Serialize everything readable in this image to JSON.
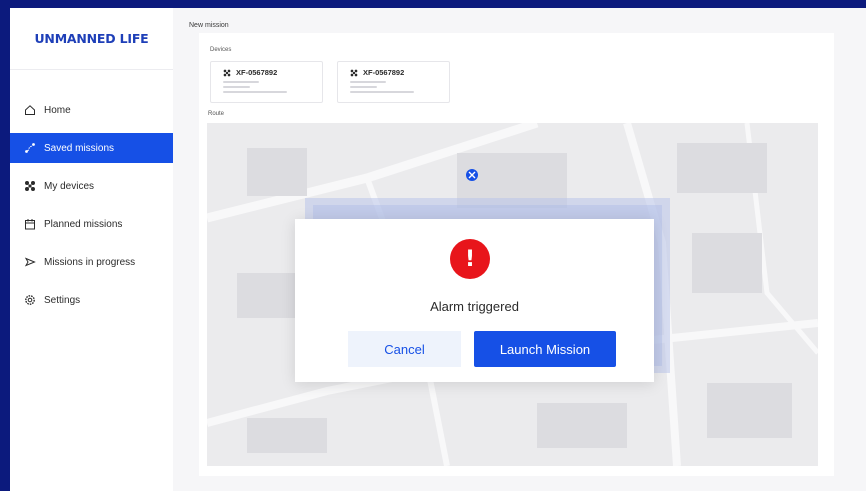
{
  "brand": {
    "logo_text": "UNMANNED LIFE",
    "accent": "#1650e6",
    "background": "#0c1a7d"
  },
  "sidebar": {
    "items": [
      {
        "label": "Home",
        "icon": "home-icon",
        "active": false
      },
      {
        "label": "Saved missions",
        "icon": "route-icon",
        "active": true
      },
      {
        "label": "My devices",
        "icon": "drone-icon",
        "active": false
      },
      {
        "label": "Planned missions",
        "icon": "calendar-icon",
        "active": false
      },
      {
        "label": "Missions in progress",
        "icon": "play-icon",
        "active": false
      },
      {
        "label": "Settings",
        "icon": "gear-icon",
        "active": false
      }
    ]
  },
  "main": {
    "page_title": "New mission",
    "devices_label": "Devices",
    "route_label": "Route",
    "devices": [
      {
        "name": "XF-0567892",
        "icon": "drone-icon"
      },
      {
        "name": "XF-0567892",
        "icon": "drone-icon"
      }
    ],
    "map": {
      "marker_icon": "drone-marker-icon"
    }
  },
  "modal": {
    "icon": "alert-icon",
    "icon_glyph": "!",
    "message": "Alarm triggered",
    "cancel_label": "Cancel",
    "launch_label": "Launch Mission",
    "alert_color": "#e8151b"
  }
}
